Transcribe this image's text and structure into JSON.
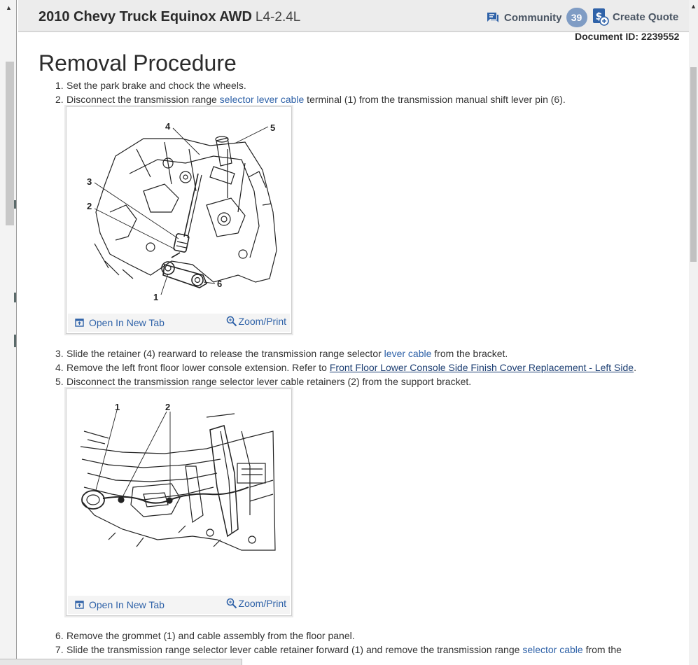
{
  "header": {
    "vehicle_title": "2010 Chevy Truck Equinox AWD",
    "engine": "L4-2.4L",
    "community_label": "Community",
    "community_count": "39",
    "create_quote_label": "Create Quote",
    "document_id": "Document ID: 2239552"
  },
  "procedure": {
    "title": "Removal Procedure",
    "steps": [
      {
        "num": "1.",
        "text": "Set the park brake and chock the wheels."
      },
      {
        "num": "2.",
        "pre": "Disconnect the transmission range ",
        "link": "selector lever cable",
        "post": " terminal (1) from the transmission manual shift lever pin (6)."
      },
      {
        "num": "3.",
        "pre": "Slide the retainer (4) rearward to release the transmission range selector ",
        "link": "lever cable",
        "post": " from the bracket."
      },
      {
        "num": "4.",
        "pre": "Remove the left front floor lower console extension. Refer to ",
        "link": "Front Floor Lower Console Side Finish Cover Replacement - Left Side",
        "post": "."
      },
      {
        "num": "5.",
        "text": "Disconnect the transmission range selector lever cable retainers (2) from the support bracket."
      },
      {
        "num": "6.",
        "text": "Remove the grommet  (1) and cable assembly from the floor panel."
      },
      {
        "num": "7.",
        "pre": "Slide the transmission range selector lever cable retainer forward (1) and remove the transmission range ",
        "link": "selector cable",
        "post": " from the"
      }
    ]
  },
  "figures": [
    {
      "open_label": "Open In New Tab",
      "zoom_label": "Zoom/Print",
      "callouts": [
        "1",
        "2",
        "3",
        "4",
        "5",
        "6"
      ]
    },
    {
      "open_label": "Open In New Tab",
      "zoom_label": "Zoom/Print",
      "callouts": [
        "1",
        "2"
      ]
    }
  ],
  "colors": {
    "link": "#2f62a8",
    "badge": "#7f9cc4",
    "header_bg": "#ececec"
  },
  "icons": [
    "community-chat-icon",
    "create-quote-dollar-icon",
    "open-new-tab-icon",
    "zoom-magnifier-icon"
  ]
}
